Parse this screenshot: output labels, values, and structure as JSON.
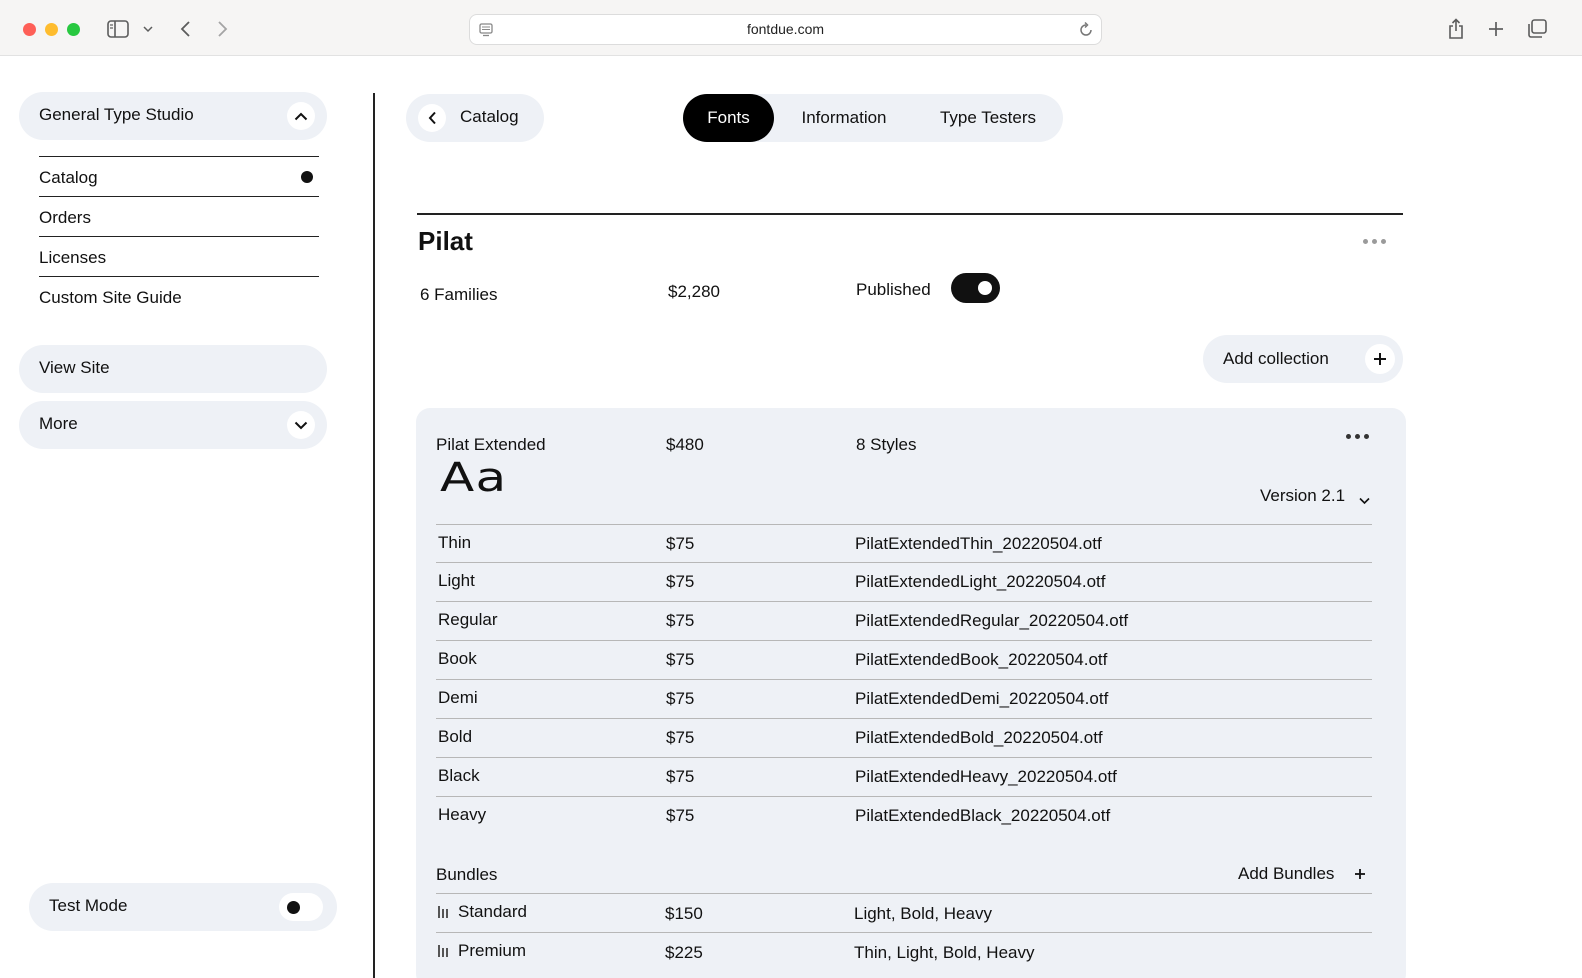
{
  "browser": {
    "url": "fontdue.com"
  },
  "sidebar": {
    "studio_name": "General Type Studio",
    "nav_items": [
      {
        "label": "Catalog",
        "active": true
      },
      {
        "label": "Orders",
        "active": false
      },
      {
        "label": "Licenses",
        "active": false
      },
      {
        "label": "Custom Site Guide",
        "active": false
      }
    ],
    "view_site_label": "View Site",
    "more_label": "More",
    "test_mode_label": "Test Mode",
    "test_mode_on": false
  },
  "header": {
    "back_label": "Catalog",
    "tabs": [
      {
        "label": "Fonts",
        "active": true
      },
      {
        "label": "Information",
        "active": false
      },
      {
        "label": "Type Testers",
        "active": false
      }
    ]
  },
  "family": {
    "name": "Pilat",
    "families_count": "6 Families",
    "price": "$2,280",
    "published_label": "Published",
    "published": true,
    "add_collection_label": "Add collection"
  },
  "collection": {
    "name": "Pilat Extended",
    "price": "$480",
    "styles_count": "8 Styles",
    "specimen": "Aa",
    "version_label": "Version 2.1",
    "styles": [
      {
        "name": "Thin",
        "price": "$75",
        "file": "PilatExtendedThin_20220504.otf"
      },
      {
        "name": "Light",
        "price": "$75",
        "file": "PilatExtendedLight_20220504.otf"
      },
      {
        "name": "Regular",
        "price": "$75",
        "file": "PilatExtendedRegular_20220504.otf"
      },
      {
        "name": "Book",
        "price": "$75",
        "file": "PilatExtendedBook_20220504.otf"
      },
      {
        "name": "Demi",
        "price": "$75",
        "file": "PilatExtendedDemi_20220504.otf"
      },
      {
        "name": "Bold",
        "price": "$75",
        "file": "PilatExtendedBold_20220504.otf"
      },
      {
        "name": "Black",
        "price": "$75",
        "file": "PilatExtendedHeavy_20220504.otf"
      },
      {
        "name": "Heavy",
        "price": "$75",
        "file": "PilatExtendedBlack_20220504.otf"
      }
    ],
    "bundles_label": "Bundles",
    "add_bundles_label": "Add Bundles",
    "bundles": [
      {
        "name": "Standard",
        "price": "$150",
        "styles": "Light, Bold, Heavy"
      },
      {
        "name": "Premium",
        "price": "$225",
        "styles": "Thin, Light, Bold, Heavy"
      }
    ]
  }
}
